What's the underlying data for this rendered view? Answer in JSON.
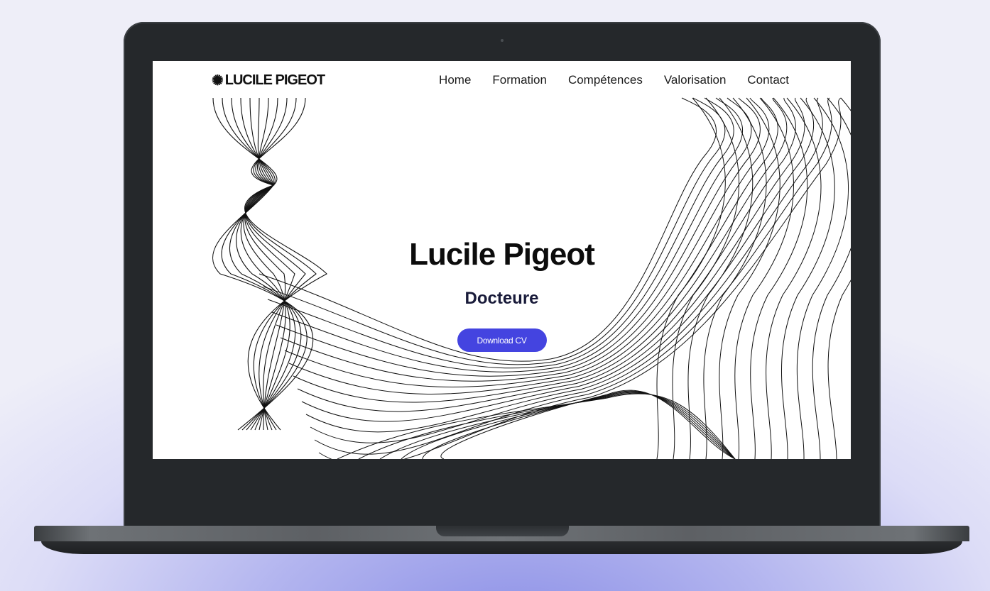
{
  "site": {
    "logo_icon": "asterisk-burst-icon",
    "logo_text": "LUCILE PIGEOT"
  },
  "nav": {
    "items": [
      {
        "label": "Home"
      },
      {
        "label": "Formation"
      },
      {
        "label": "Compétences"
      },
      {
        "label": "Valorisation"
      },
      {
        "label": "Contact"
      }
    ]
  },
  "hero": {
    "name": "Lucile Pigeot",
    "title": "Docteure",
    "cta_label": "Download CV"
  },
  "colors": {
    "accent": "#4444e0",
    "background_gradient": "#8a8ee6",
    "laptop_body": "#25282b"
  }
}
